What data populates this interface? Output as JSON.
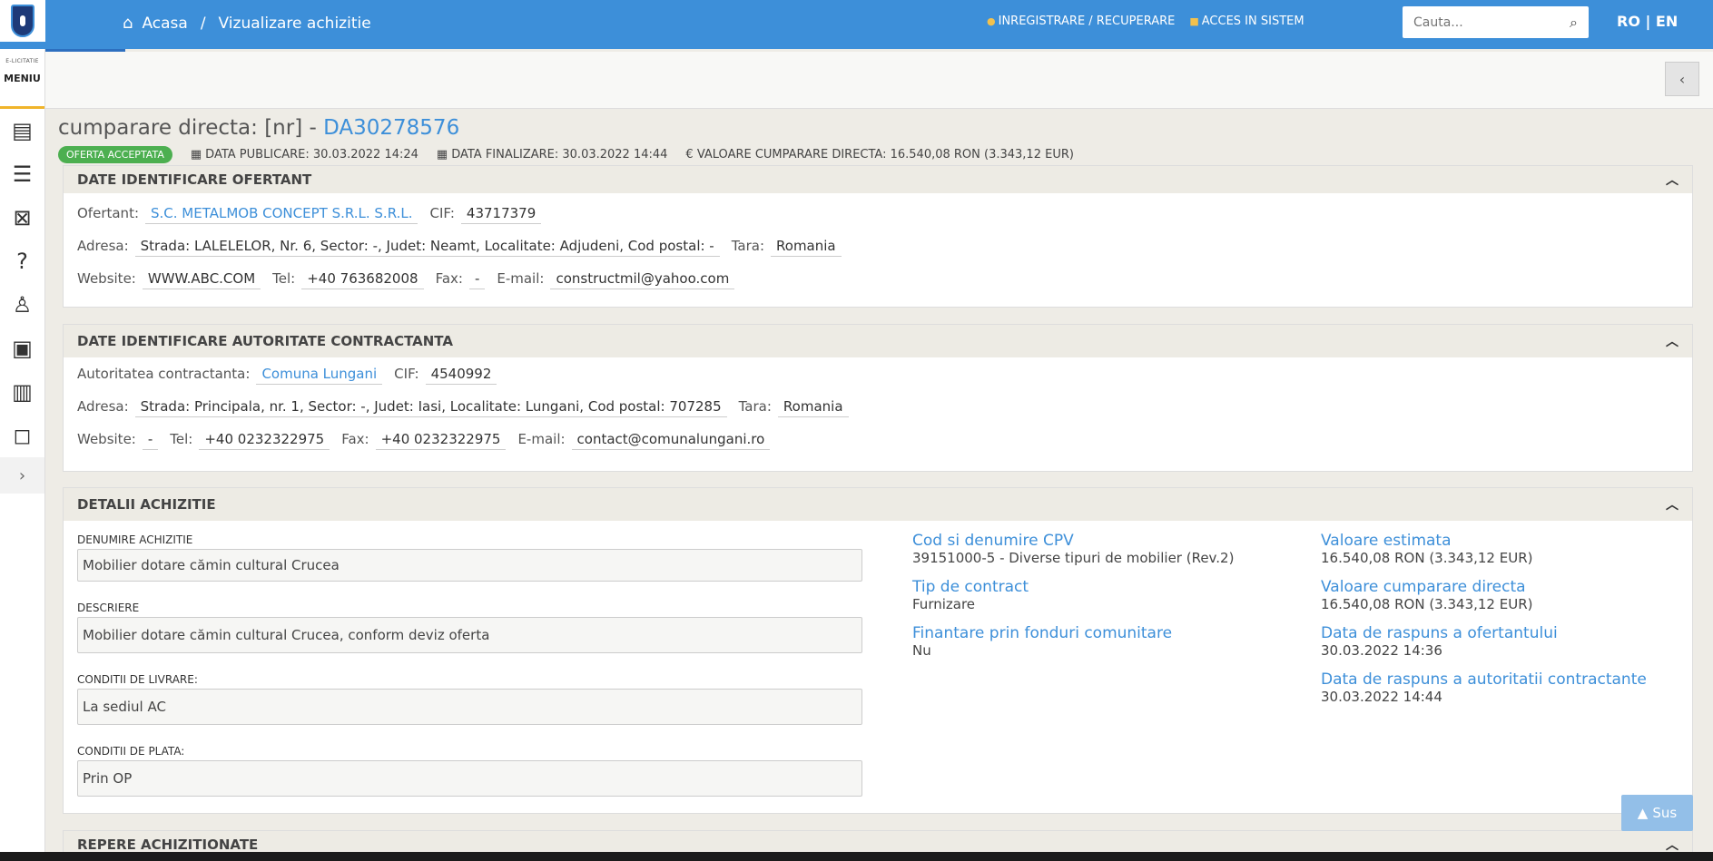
{
  "header": {
    "breadcrumb": {
      "home": "Acasa",
      "sep": "/",
      "current": "Vizualizare achizitie"
    },
    "links": {
      "register": "INREGISTRARE / RECUPERARE",
      "login": "ACCES IN SISTEM"
    },
    "search": {
      "placeholder": "Cauta..."
    },
    "lang": "RO | EN"
  },
  "sidebar": {
    "brand_small": "E-LICITATIE",
    "menu_label": "MENIU",
    "icons": [
      "document-icon",
      "list-icon",
      "bag-icon",
      "help-icon",
      "user-tree-icon",
      "id-card-icon",
      "catalog-icon",
      "chat-icon"
    ]
  },
  "page": {
    "title_prefix": "cumparare directa: [nr] - ",
    "title_id": "DA30278576",
    "status_badge": "OFERTA ACCEPTATA",
    "data_publicare": "DATA PUBLICARE: 30.03.2022 14:24",
    "data_finalizare": "DATA FINALIZARE: 30.03.2022 14:44",
    "valoare": "€ VALOARE CUMPARARE DIRECTA: 16.540,08  RON (3.343,12  EUR)"
  },
  "ofertant": {
    "header": "DATE IDENTIFICARE OFERTANT",
    "ofertant_label": "Ofertant:",
    "ofertant_value": "S.C. METALMOB CONCEPT S.R.L. S.R.L.",
    "cif_label": "CIF:",
    "cif_value": "43717379",
    "adresa_label": "Adresa:",
    "adresa_value": "Strada: LALELELOR, Nr. 6, Sector: -, Judet: Neamt, Localitate: Adjudeni, Cod postal: -",
    "tara_label": "Tara:",
    "tara_value": "Romania",
    "website_label": "Website:",
    "website_value": "WWW.ABC.COM",
    "tel_label": "Tel:",
    "tel_value": "+40 763682008",
    "fax_label": "Fax:",
    "fax_value": "-",
    "email_label": "E-mail:",
    "email_value": "constructmil@yahoo.com"
  },
  "autoritate": {
    "header": "DATE IDENTIFICARE AUTORITATE CONTRACTANTA",
    "autoritate_label": "Autoritatea contractanta:",
    "autoritate_value": "Comuna Lungani",
    "cif_label": "CIF:",
    "cif_value": "4540992",
    "adresa_label": "Adresa:",
    "adresa_value": "Strada: Principala, nr. 1, Sector: -, Judet: Iasi, Localitate: Lungani, Cod postal: 707285",
    "tara_label": "Tara:",
    "tara_value": "Romania",
    "website_label": "Website:",
    "website_value": "-",
    "tel_label": "Tel:",
    "tel_value": "+40 0232322975",
    "fax_label": "Fax:",
    "fax_value": "+40 0232322975",
    "email_label": "E-mail:",
    "email_value": "contact@comunalungani.ro"
  },
  "detalii": {
    "header": "DETALII ACHIZITIE",
    "denumire_label": "DENUMIRE ACHIZITIE",
    "denumire_value": "Mobilier dotare cămin cultural Crucea",
    "descriere_label": "DESCRIERE",
    "descriere_value": "Mobilier dotare cămin cultural Crucea, conform deviz oferta",
    "livrare_label": "CONDITII DE LIVRARE:",
    "livrare_value": "La sediul AC",
    "plata_label": "CONDITII DE PLATA:",
    "plata_value": "Prin OP",
    "cpv_title": "Cod si denumire CPV",
    "cpv_value": "39151000-5 - Diverse tipuri de mobilier (Rev.2)",
    "tip_title": "Tip de contract",
    "tip_value": "Furnizare",
    "finantare_title": "Finantare prin fonduri comunitare",
    "finantare_value": "Nu",
    "estimata_title": "Valoare estimata",
    "estimata_value": "16.540,08  RON (3.343,12  EUR)",
    "cumparare_title": "Valoare cumparare directa",
    "cumparare_value": "16.540,08  RON (3.343,12  EUR)",
    "raspuns_ofertant_title": "Data de raspuns a ofertantului",
    "raspuns_ofertant_value": "30.03.2022 14:36",
    "raspuns_ac_title": "Data de raspuns a autoritatii contractante",
    "raspuns_ac_value": "30.03.2022 14:44"
  },
  "repere": {
    "header": "REPERE ACHIZITIONATE"
  },
  "sus_button": "Sus",
  "colors": {
    "primary": "#3d8fd9",
    "accepted": "#4caf50",
    "accent": "#f0b42a"
  }
}
